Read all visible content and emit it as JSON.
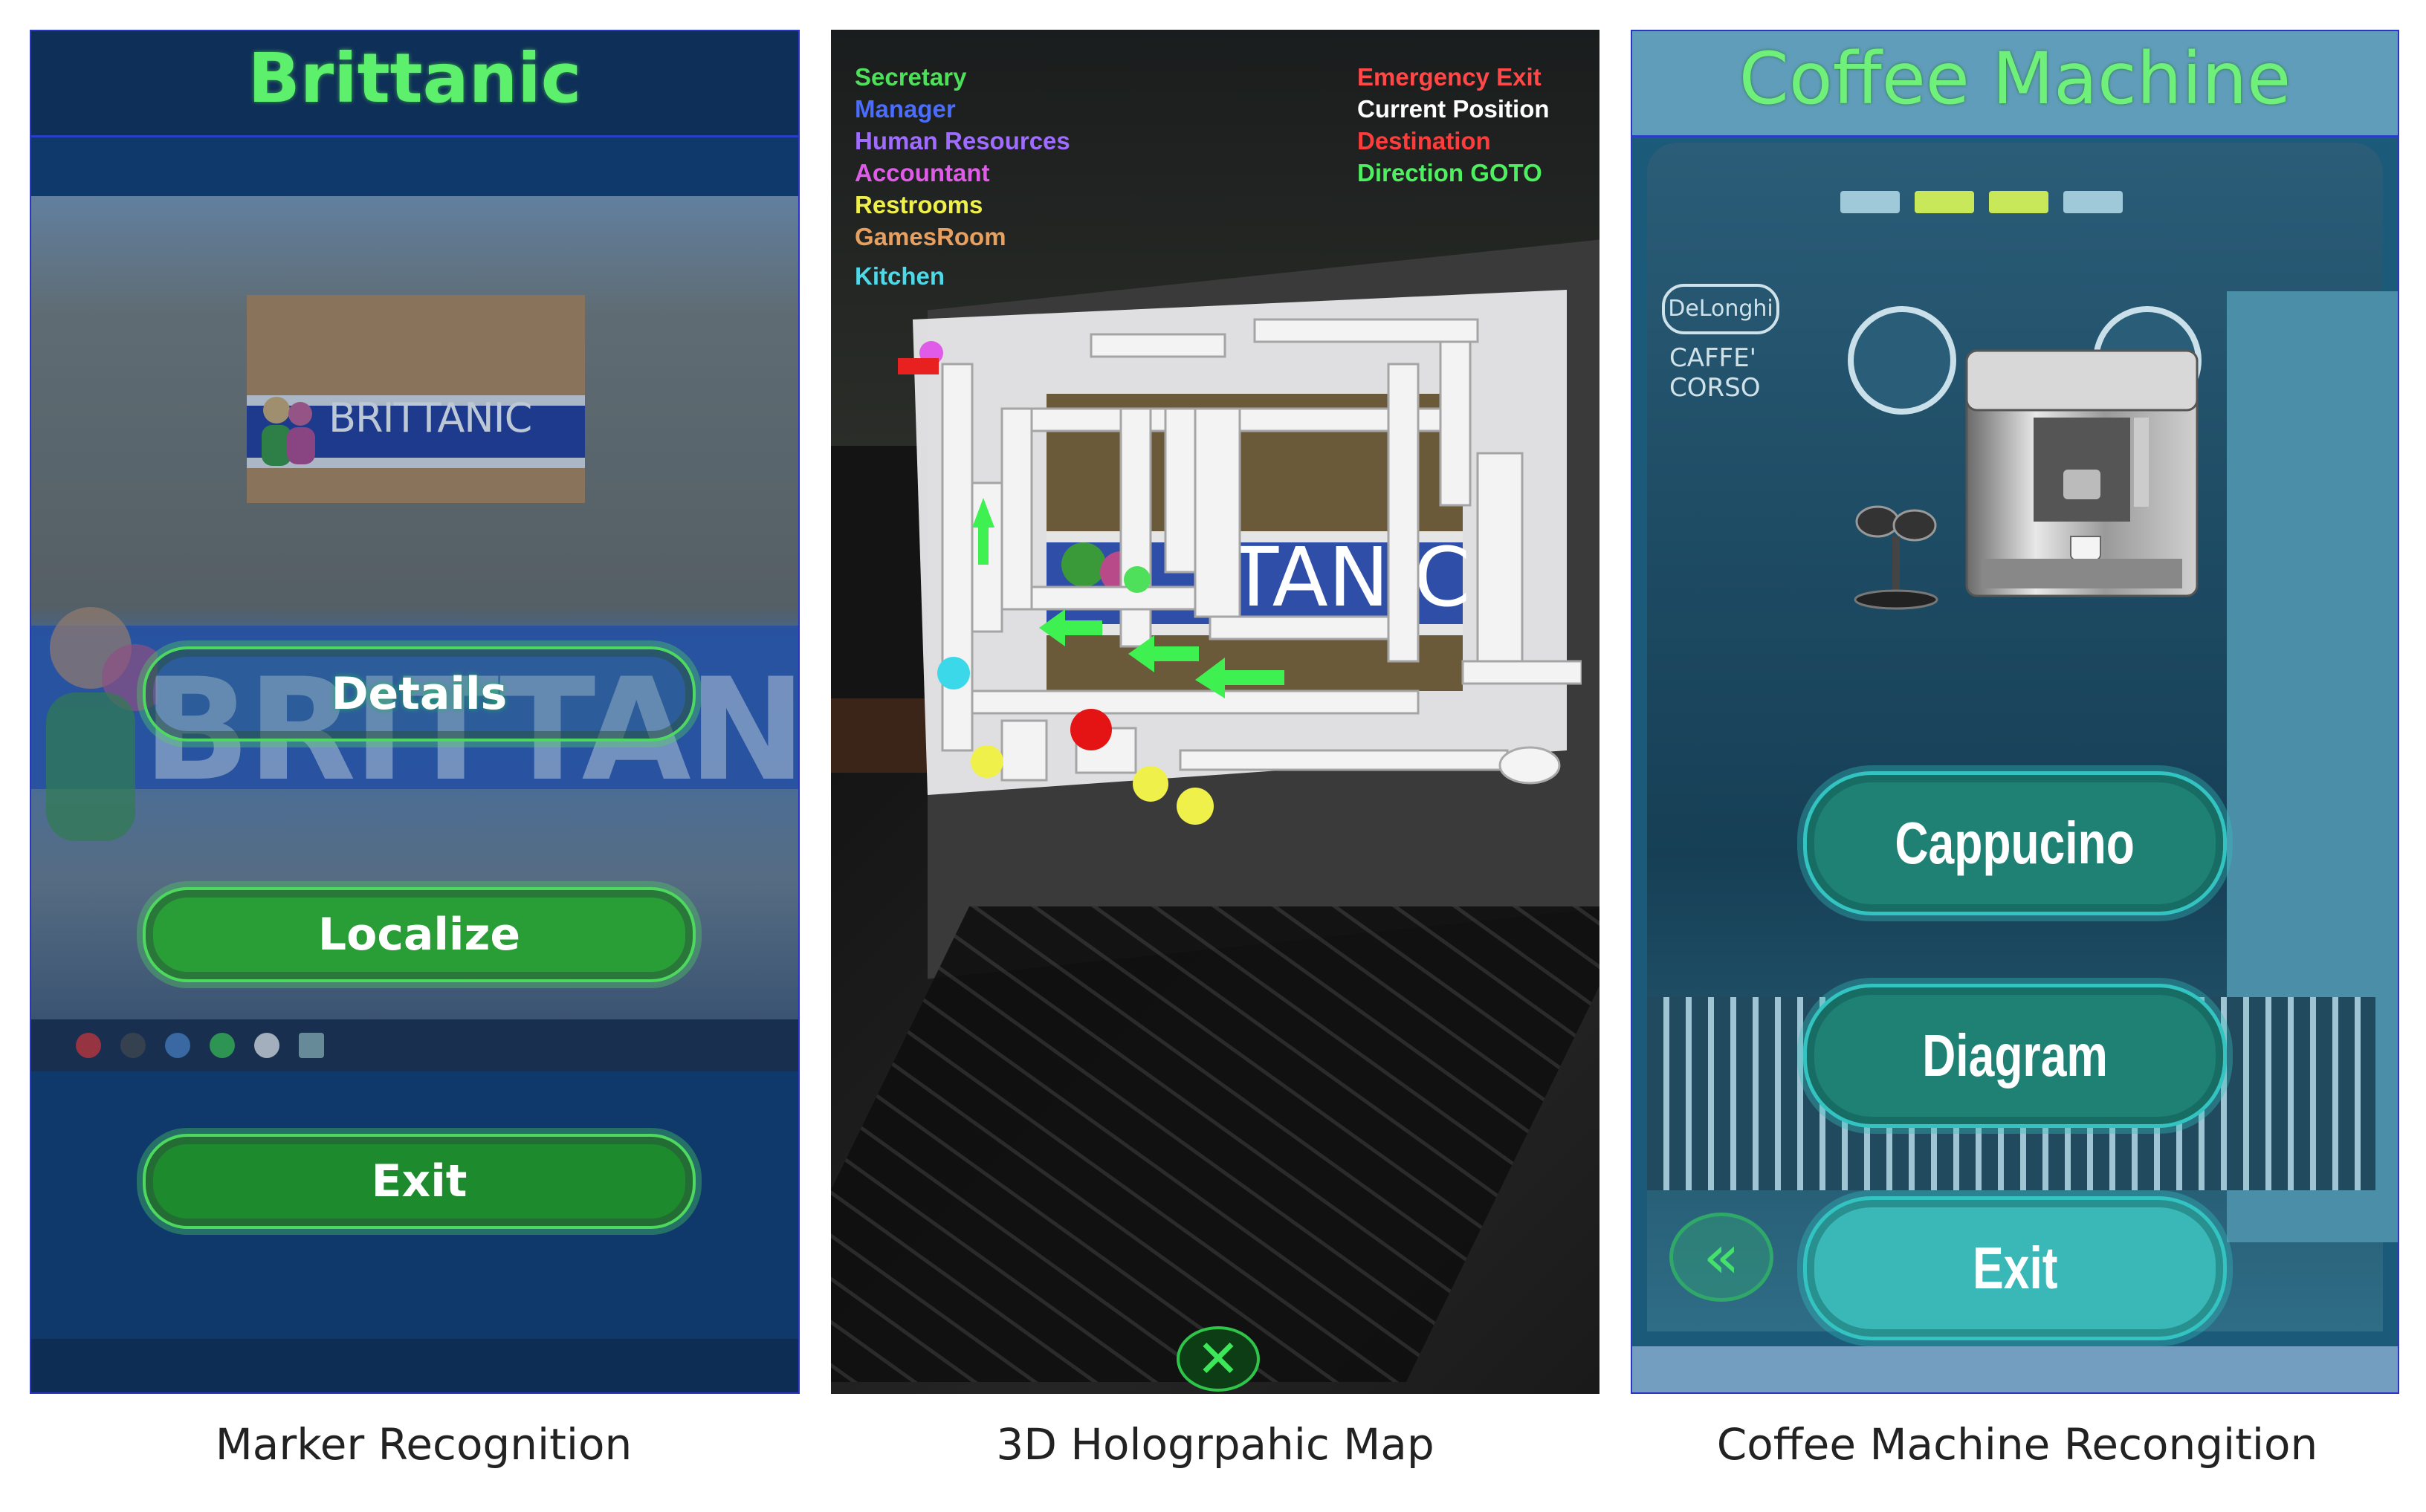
{
  "panels": {
    "marker": {
      "title": "Brittanic",
      "photo_label": "BRITTANIC",
      "background_text": "BRITTANIC",
      "buttons": {
        "details": "Details",
        "localize": "Localize",
        "exit": "Exit"
      },
      "caption": "Marker Recognition"
    },
    "map": {
      "legend_left": [
        {
          "label": "Secretary",
          "color": "#4ee05a"
        },
        {
          "label": "Manager",
          "color": "#4a6cff"
        },
        {
          "label": "Human Resources",
          "color": "#9f6cff"
        },
        {
          "label": "Accountant",
          "color": "#e05ce8"
        },
        {
          "label": "Restrooms",
          "color": "#f0f04a"
        },
        {
          "label": "GamesRoom",
          "color": "#e8a060"
        },
        {
          "label": "Kitchen",
          "color": "#4ed8e8"
        }
      ],
      "legend_right": [
        {
          "label": "Emergency Exit",
          "color": "#ff4848"
        },
        {
          "label": "Current Position",
          "color": "#ffffff"
        },
        {
          "label": "Destination",
          "color": "#ff3c3c"
        },
        {
          "label": "Direction GOTO",
          "color": "#4ef060"
        }
      ],
      "sign_text": "TANIC",
      "close_icon": "close-x-icon",
      "caption": "3D Hologrpahic Map"
    },
    "coffee": {
      "title": "Coffee Machine",
      "brand_badge": "DeLonghi",
      "brand_line1": "CAFFE'",
      "brand_line2": "CORSO",
      "buttons": {
        "cappuccino": "Cappucino",
        "diagram": "Diagram",
        "exit": "Exit"
      },
      "back_icon": "double-chevron-left-icon",
      "caption": "Coffee Machine Recongition"
    }
  }
}
